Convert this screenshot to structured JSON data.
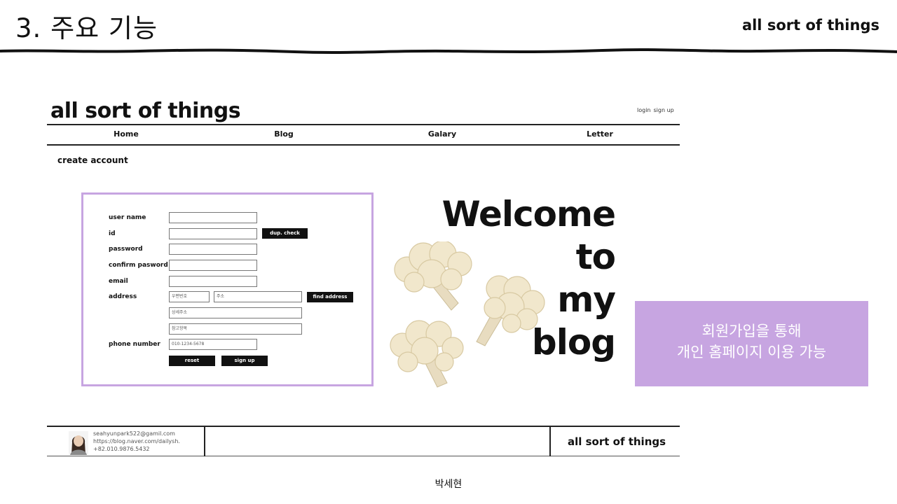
{
  "slide": {
    "title": "3. 주요 기능",
    "brand": "all sort of things",
    "author": "박세현"
  },
  "site": {
    "logo": "all sort of things",
    "auth": {
      "login": "login",
      "signup": "sign up"
    },
    "nav": [
      "Home",
      "Blog",
      "Galary",
      "Letter"
    ],
    "page_heading": "create account"
  },
  "form": {
    "labels": {
      "username": "user name",
      "id": "id",
      "password": "password",
      "confirm": "confirm pasword",
      "email": "email",
      "address": "address",
      "phone": "phone number"
    },
    "placeholders": {
      "postcode": "우편번호",
      "address": "주소",
      "detail": "상세주소",
      "extra": "참고항목",
      "phone": "010-1234-5678"
    },
    "buttons": {
      "dup_check": "dup. check",
      "find_address": "find address",
      "reset": "reset",
      "signup": "sign up"
    }
  },
  "welcome": {
    "line1": "Welcome",
    "line2": "to",
    "line3": "my",
    "line4": "blog"
  },
  "callout": {
    "line1": "회원가입을 통해",
    "line2": "개인 홈페이지 이용 가능"
  },
  "footer": {
    "email": "seahyunpark522@gamil.com",
    "blog": "https://blog.naver.com/dailysh.",
    "phone": "+82.010.9876.5432",
    "brand": "all sort of things"
  },
  "colors": {
    "accent": "#c7a5e1",
    "ink": "#111111"
  }
}
